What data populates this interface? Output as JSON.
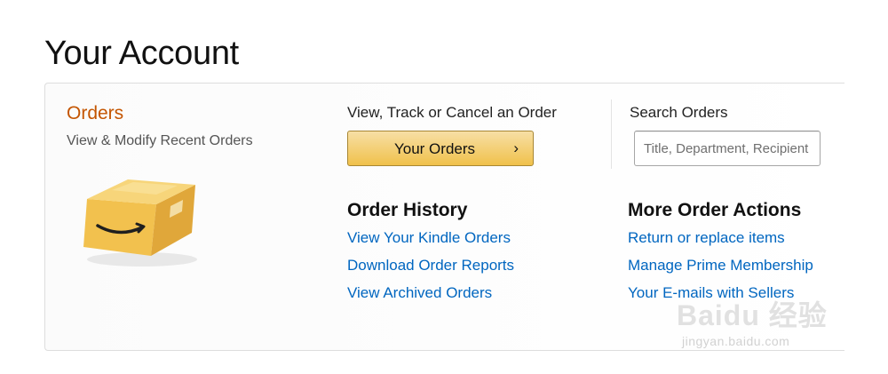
{
  "page": {
    "title": "Your Account"
  },
  "orders": {
    "heading": "Orders",
    "subtitle": "View & Modify Recent Orders",
    "track_label": "View, Track or Cancel an Order",
    "button_label": "Your Orders",
    "button_chevron": "›",
    "search": {
      "label": "Search Orders",
      "placeholder": "Title, Department, Recipient",
      "value": ""
    }
  },
  "order_history": {
    "heading": "Order History",
    "links": [
      "View Your Kindle Orders",
      "Download Order Reports",
      "View Archived Orders"
    ]
  },
  "more_actions": {
    "heading": "More Order Actions",
    "links": [
      "Return or replace items",
      "Manage Prime Membership",
      "Your E-mails with Sellers"
    ]
  },
  "watermark": {
    "brand": "Baidu 经验",
    "url": "jingyan.baidu.com"
  },
  "colors": {
    "orders_heading": "#c45500",
    "link": "#0066c0",
    "button_top": "#f7dfa5",
    "button_bottom": "#f0c14b",
    "button_border": "#a88734"
  }
}
